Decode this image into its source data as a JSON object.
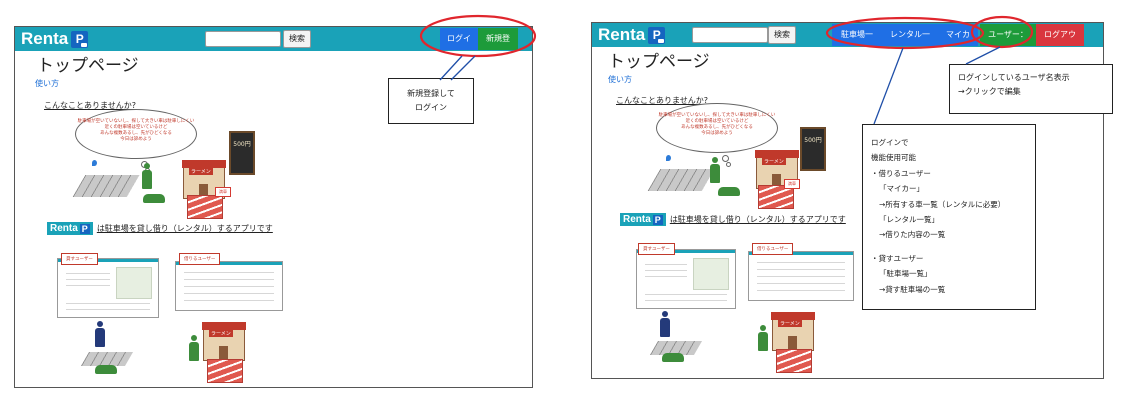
{
  "left": {
    "navbar": {
      "brand": "Renta",
      "brand_logo": "P",
      "search_button": "検索",
      "login_button": "ログイン",
      "signup_button": "新規登録"
    },
    "page_title": "トップページ",
    "howto_link": "使い方",
    "question": "こんなことありませんか?",
    "cloud_lines": [
      "駐車場が空いていないし、探して大きい車は駐車しにくい",
      "近くの駐車場は空いているけど",
      "あんな複数あるし、先がひどくなる",
      "今日は諦めよう"
    ],
    "tag_label": "満車",
    "app_sentence": "は駐車場を貸し借り（レンタル）するアプリです",
    "lender_label": "貸すユーザー",
    "borrower_label": "借りるユーザー",
    "shop_sign": "ラーメン",
    "chalkboard_text": "500円",
    "callout_lines": [
      "新規登録して",
      "ログイン"
    ]
  },
  "right": {
    "navbar": {
      "brand": "Renta",
      "brand_logo": "P",
      "search_button": "検索",
      "parking_list_button": "駐車場一覧",
      "rental_list_button": "レンタル一覧",
      "mycar_button": "マイカー",
      "user_button": "ユーザー：ryo",
      "logout_button": "ログアウト"
    },
    "page_title": "トップページ",
    "howto_link": "使い方",
    "question": "こんなことありませんか?",
    "cloud_lines": [
      "駐車場が空いていないし、探して大きい車は駐車しにくい",
      "近くの駐車場は空いているけど",
      "あんな複数あるし、先がひどくなる",
      "今日は諦めよう"
    ],
    "tag_label": "満車",
    "app_sentence": "は駐車場を貸し借り（レンタル）するアプリです",
    "lender_label": "貸すユーザー",
    "borrower_label": "借りるユーザー",
    "shop_sign": "ラーメン",
    "chalkboard_text": "500円",
    "callout_user_lines": [
      "ログインしているユーザ名表示",
      "→クリックで編集"
    ],
    "callout_features_lines": [
      "ログインで",
      "機能使用可能",
      "・借りるユーザー",
      "「マイカー」",
      "→所有する車一覧（レンタルに必要）",
      "「レンタル一覧」",
      "→借りた内容の一覧",
      "",
      "・貸すユーザー",
      "「駐車場一覧」",
      "→貸す駐車場の一覧"
    ]
  },
  "colors": {
    "navbar": "#1aa2b8",
    "button_blue": "#1f6fe5",
    "button_green": "#1d9b3a",
    "button_red": "#d9363e",
    "highlight_ellipse": "#e0262d"
  }
}
